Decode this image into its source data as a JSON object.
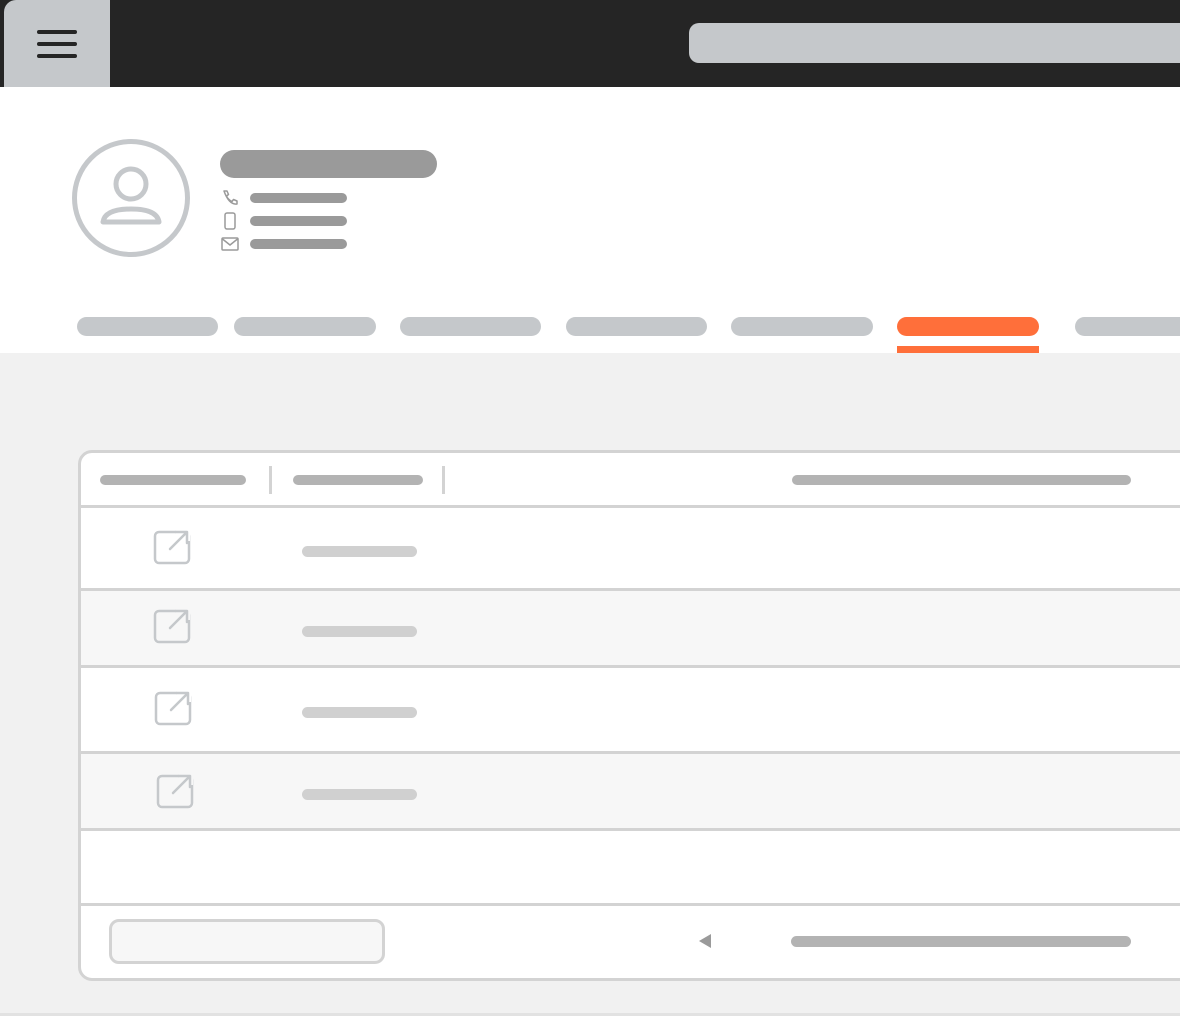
{
  "colors": {
    "topbar": "#252525",
    "accent": "#ff6f3a",
    "placeholder_light": "#c5c8cb",
    "placeholder_dark": "#9a9a9a",
    "content_bg": "#f1f1f1",
    "border": "#d3d3d3"
  },
  "topbar": {
    "menu_icon": "hamburger-menu-icon",
    "search_value": ""
  },
  "profile": {
    "avatar_icon": "user-avatar-icon",
    "name": "",
    "contacts": [
      {
        "icon": "phone-icon",
        "value": ""
      },
      {
        "icon": "mobile-phone-icon",
        "value": ""
      },
      {
        "icon": "mail-icon",
        "value": ""
      }
    ]
  },
  "tabs": {
    "active_index": 5,
    "items": [
      {
        "label": ""
      },
      {
        "label": ""
      },
      {
        "label": ""
      },
      {
        "label": ""
      },
      {
        "label": ""
      },
      {
        "label": ""
      },
      {
        "label": ""
      }
    ]
  },
  "table": {
    "headers": [
      "",
      "",
      ""
    ],
    "rows": [
      {
        "edit_icon": "edit-external-icon",
        "value": ""
      },
      {
        "edit_icon": "edit-external-icon",
        "value": ""
      },
      {
        "edit_icon": "edit-external-icon",
        "value": ""
      },
      {
        "edit_icon": "edit-external-icon",
        "value": ""
      }
    ],
    "footer": {
      "page_input_value": "",
      "prev_icon": "triangle-left-icon",
      "pagination_text": ""
    }
  }
}
